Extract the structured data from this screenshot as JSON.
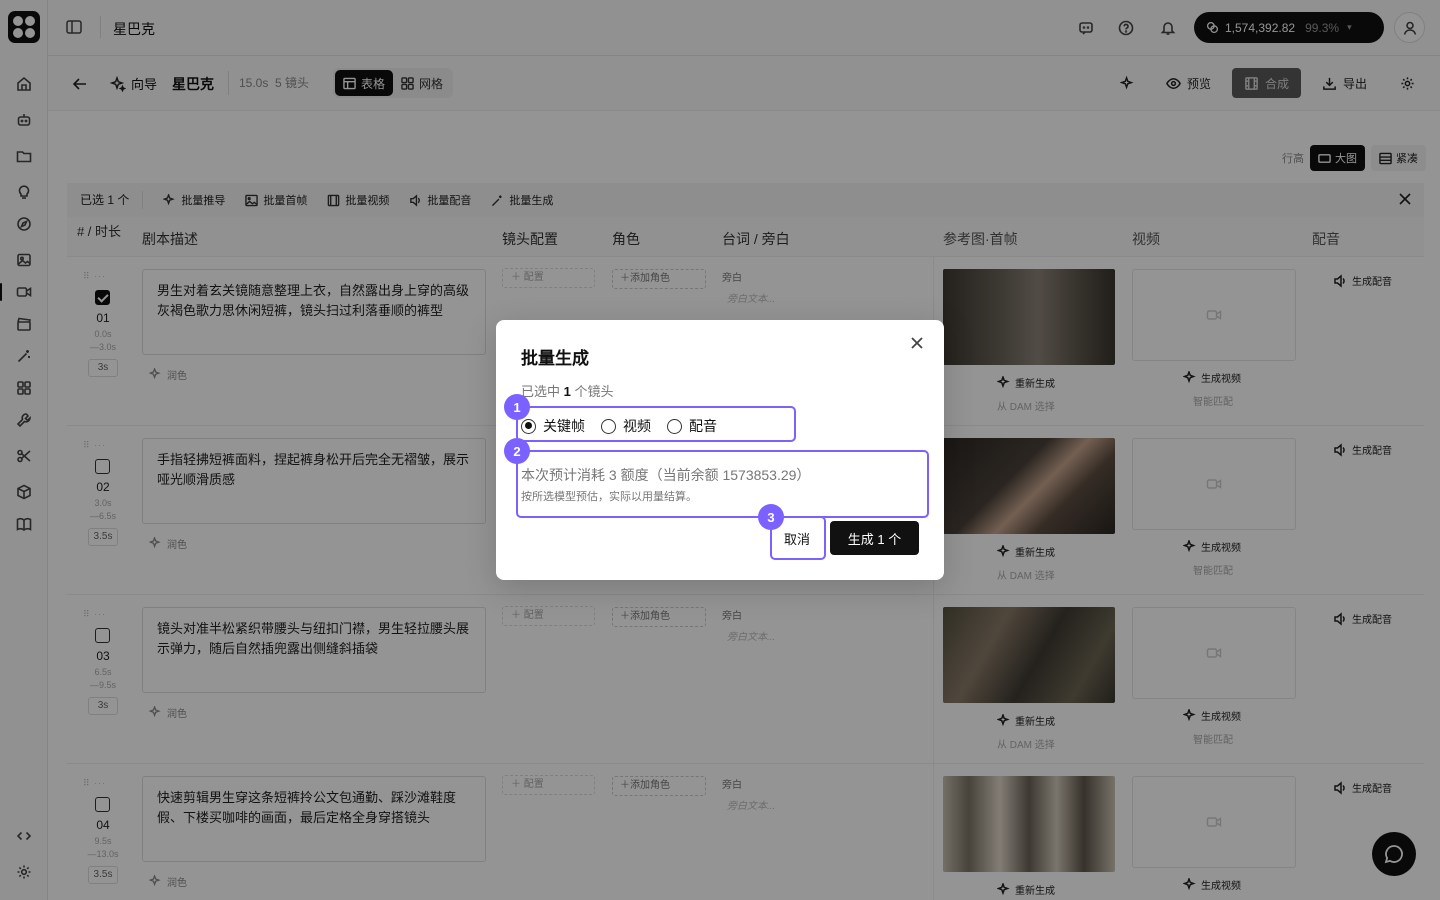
{
  "app": {
    "project_title": "星巴克"
  },
  "topbar": {
    "balance": "1,574,392.82",
    "balance_pct": "99.3%"
  },
  "project": {
    "guide_label": "向导",
    "name": "星巴克",
    "duration": "15.0s",
    "shots": "5 镜头",
    "view_table": "表格",
    "view_grid": "网格",
    "preview": "预览",
    "compose": "合成",
    "export": "导出"
  },
  "toolbar": {
    "row_height_label": "行高",
    "large": "大图",
    "compact": "紧凑"
  },
  "bulk": {
    "selected": "已选 1 个",
    "recommend": "批量推导",
    "first_frame": "批量首帧",
    "video": "批量视频",
    "dubbing": "批量配音",
    "generate": "批量生成"
  },
  "table": {
    "headers": {
      "num": "# / 时长",
      "script": "剧本描述",
      "shot": "镜头配置",
      "role": "角色",
      "lines": "台词 / 旁白",
      "ref": "参考图·首帧",
      "video": "视频",
      "audio": "配音"
    },
    "labels": {
      "polish": "润色",
      "config": "配置",
      "add_role": "添加角色",
      "vo_label": "旁白",
      "vo_placeholder": "旁白文本...",
      "regen": "重新生成",
      "dam": "从 DAM 选择",
      "gen_video": "生成视频",
      "smart_match": "智能匹配",
      "gen_audio": "生成配音"
    },
    "rows": [
      {
        "num": "01",
        "time_start": "0.0s",
        "time_end": "—3.0s",
        "dur": "3s",
        "checked": true,
        "script": "男生对着玄关镜随意整理上衣，自然露出身上穿的高级灰褐色歌力思休闲短裤，镜头扫过利落垂顺的裤型"
      },
      {
        "num": "02",
        "time_start": "3.0s",
        "time_end": "—6.5s",
        "dur": "3.5s",
        "checked": false,
        "script": "手指轻拂短裤面料，捏起裤身松开后完全无褶皱，展示哑光顺滑质感"
      },
      {
        "num": "03",
        "time_start": "6.5s",
        "time_end": "—9.5s",
        "dur": "3s",
        "checked": false,
        "script": "镜头对准半松紧织带腰头与纽扣门襟，男生轻拉腰头展示弹力，随后自然插兜露出侧缝斜插袋"
      },
      {
        "num": "04",
        "time_start": "9.5s",
        "time_end": "—13.0s",
        "dur": "3.5s",
        "checked": false,
        "script": "快速剪辑男生穿这条短裤拎公文包通勤、踩沙滩鞋度假、下楼买咖啡的画面，最后定格全身穿搭镜头"
      }
    ]
  },
  "modal": {
    "title": "批量生成",
    "selected_prefix": "已选中",
    "selected_count": "1",
    "selected_suffix": "个镜头",
    "opt_keyframe": "关键帧",
    "opt_video": "视频",
    "opt_dubbing": "配音",
    "cost": "本次预计消耗 3 额度（当前余额 1573853.29）",
    "note": "按所选模型预估，实际以用量结算。",
    "cancel": "取消",
    "generate": "生成 1 个",
    "badges": [
      "1",
      "2",
      "3"
    ]
  }
}
